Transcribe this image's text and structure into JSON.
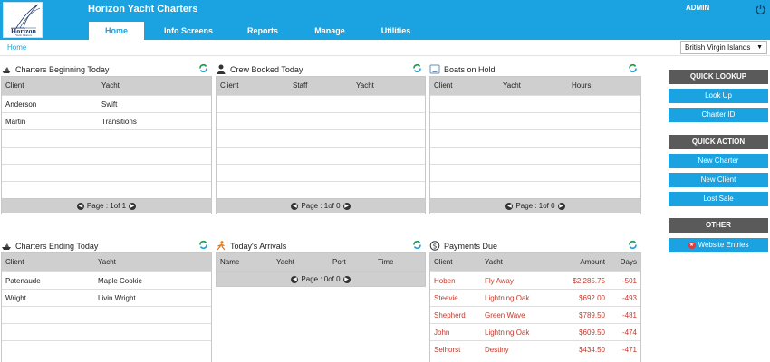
{
  "app": {
    "title": "Horizon Yacht Charters",
    "user": "ADMIN",
    "logo_text": "Horizon",
    "logo_sub": "Yacht Charters"
  },
  "nav": {
    "tabs": [
      {
        "label": "Home",
        "active": true
      },
      {
        "label": "Info Screens",
        "active": false
      },
      {
        "label": "Reports",
        "active": false
      },
      {
        "label": "Manage",
        "active": false
      },
      {
        "label": "Utilities",
        "active": false
      }
    ]
  },
  "breadcrumb": "Home",
  "region": {
    "selected": "British Virgin Islands"
  },
  "panels": {
    "charters_beginning": {
      "title": "Charters Beginning Today",
      "columns": [
        "Client",
        "Yacht"
      ],
      "rows": [
        [
          "Anderson",
          "Swift"
        ],
        [
          "Martin",
          "Transitions"
        ]
      ],
      "footer": "Page : 1of 1"
    },
    "crew_booked": {
      "title": "Crew Booked Today",
      "columns": [
        "Client",
        "Staff",
        "Yacht"
      ],
      "rows": [],
      "footer": "Page : 1of 0"
    },
    "boats_on_hold": {
      "title": "Boats on Hold",
      "columns": [
        "Client",
        "Yacht",
        "Hours"
      ],
      "rows": [],
      "footer": "Page : 1of 0"
    },
    "charters_ending": {
      "title": "Charters Ending Today",
      "columns": [
        "Client",
        "Yacht"
      ],
      "rows": [
        [
          "Patenaude",
          "Maple Cookie"
        ],
        [
          "Wright",
          "Livin Wright"
        ]
      ]
    },
    "arrivals": {
      "title": "Today's Arrivals",
      "columns": [
        "Name",
        "Yacht",
        "Port",
        "Time"
      ],
      "rows": [],
      "footer": "Page : 0of 0"
    },
    "payments_due": {
      "title": "Payments Due",
      "columns": [
        "Client",
        "Yacht",
        "Amount",
        "Days"
      ],
      "rows": [
        [
          "Hoben",
          "Fly Away",
          "$2,285.75",
          "-501"
        ],
        [
          "Steevie",
          "Lightning Oak",
          "$692.00",
          "-493"
        ],
        [
          "Shepherd",
          "Green Wave",
          "$789.50",
          "-481"
        ],
        [
          "John",
          "Lightning Oak",
          "$609.50",
          "-474"
        ],
        [
          "Selhorst",
          "Destiny",
          "$434.50",
          "-471"
        ]
      ]
    }
  },
  "sidebar": {
    "quick_lookup": {
      "title": "QUICK LOOKUP",
      "items": [
        "Look Up",
        "Charter ID"
      ]
    },
    "quick_action": {
      "title": "QUICK ACTION",
      "items": [
        "New Charter",
        "New Client",
        "Lost Sale"
      ]
    },
    "other": {
      "title": "OTHER",
      "items": [
        "Website Entries"
      ]
    }
  },
  "colors": {
    "accent": "#1aa3e0",
    "header_gray": "#5a5a5a",
    "due_red": "#c0392b"
  }
}
